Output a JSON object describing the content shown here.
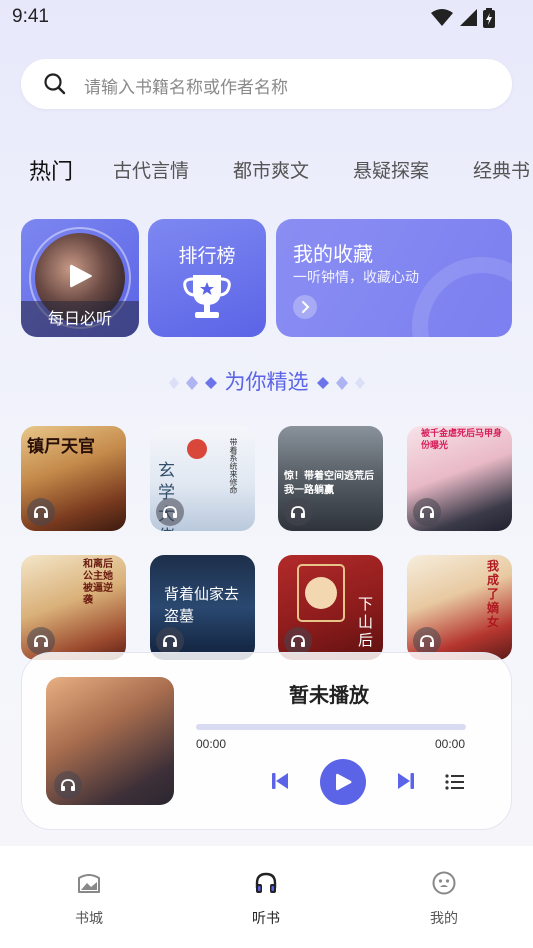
{
  "status_bar": {
    "time": "9:41"
  },
  "search": {
    "placeholder": "请输入书籍名称或作者名称"
  },
  "tabs": [
    {
      "label": "热门",
      "active": true
    },
    {
      "label": "古代言情"
    },
    {
      "label": "都市爽文"
    },
    {
      "label": "悬疑探案"
    },
    {
      "label": "经典书"
    }
  ],
  "features": {
    "daily": {
      "label": "每日必听"
    },
    "ranking": {
      "label": "排行榜"
    },
    "favorites": {
      "title": "我的收藏",
      "subtitle": "一听钟情，收藏心动"
    }
  },
  "section": {
    "title": "为你精选"
  },
  "books": [
    {
      "cover_text": "镇尸天官"
    },
    {
      "cover_text": "玄学大佬",
      "cover_side_text": "带着系统来修命"
    },
    {
      "cover_text": "惊！带着空间逃荒后我一路躺赢"
    },
    {
      "cover_text": "被千金虐死后马甲身份曝光"
    },
    {
      "cover_text": "和离后公主她被逼逆袭"
    },
    {
      "cover_text": "背着仙家去盗墓"
    },
    {
      "cover_text": "下山后"
    },
    {
      "cover_text": "我成了嫡女"
    }
  ],
  "player": {
    "title": "暂未播放",
    "time_start": "00:00",
    "time_end": "00:00",
    "progress": 0
  },
  "bottom_nav": [
    {
      "label": "书城"
    },
    {
      "label": "听书",
      "active": true
    },
    {
      "label": "我的"
    }
  ],
  "colors": {
    "accent": "#5b64e6",
    "background": "#eef0fb"
  }
}
